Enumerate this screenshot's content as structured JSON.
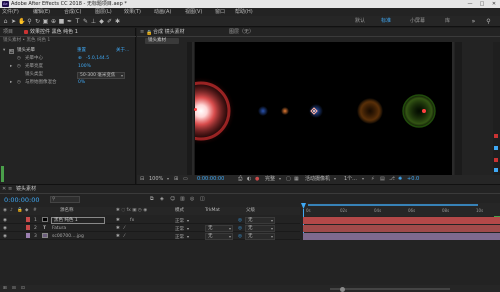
{
  "app": {
    "title": "Adobe After Effects CC 2018 - 无标题项目.aep *",
    "logo": "Ae"
  },
  "window_controls": [
    "—",
    "□",
    "✕"
  ],
  "menu": [
    "文件(F)",
    "编辑(E)",
    "合成(C)",
    "图层(L)",
    "效果(T)",
    "动画(A)",
    "视图(V)",
    "窗口",
    "帮助(H)"
  ],
  "workspaces": [
    "默认",
    "标准",
    "小屏幕",
    "库"
  ],
  "left_panel": {
    "tabs": [
      "项目",
      "效果控件 黑色 纯色 1"
    ],
    "breadcrumb": "镜头素材 • 黑色 纯色 1",
    "effect_name": "镜头光晕",
    "reset_label": "重置",
    "about_label": "关于...",
    "props": [
      {
        "label": "光晕中心",
        "value": "-5.0,144.5"
      },
      {
        "label": "光晕亮度",
        "value": "100%"
      },
      {
        "label": "镜头类型",
        "value": "50-300 毫米变焦"
      },
      {
        "label": "与原始图像混合",
        "value": "0%"
      }
    ]
  },
  "viewer": {
    "lock_label": "合成 镜头素材",
    "layer_tab": "图层（无）",
    "comp_tab": "镜头素材",
    "bottom": {
      "zoom": "100%",
      "time": "0:00:00:00",
      "quality": "完整",
      "camera": "活动摄像机",
      "views": "1个...",
      "exposure": "+0.0"
    }
  },
  "timeline": {
    "comp_tab": "镜头素材",
    "timecode": "0:00:00:00",
    "columns": {
      "source_name": "源名称",
      "mode": "模式",
      "trkmat": "TrkMat",
      "parent": "父级"
    },
    "ruler": [
      "0s",
      "02s",
      "04s",
      "06s",
      "08s",
      "10s"
    ],
    "layers": [
      {
        "index": "1",
        "name": "黑色 纯色 1",
        "mode": "正常",
        "trkmat": "",
        "parent": "无",
        "label_color": "#c94a4a",
        "bar_color": "#b34848"
      },
      {
        "index": "2",
        "name": "Fatura",
        "mode": "正常",
        "trkmat": "无",
        "parent": "无",
        "label_color": "#c94a4a",
        "bar_color": "#a04a4a"
      },
      {
        "index": "3",
        "name": "sc00700....jpg",
        "mode": "正常",
        "trkmat": "无",
        "parent": "无",
        "label_color": "#9b7fb0",
        "bar_color": "#7e6a8e"
      }
    ]
  },
  "colors": {
    "accent": "#3fa9f5",
    "flare_red": "#ff4444",
    "flare_orange": "#d2781e"
  }
}
